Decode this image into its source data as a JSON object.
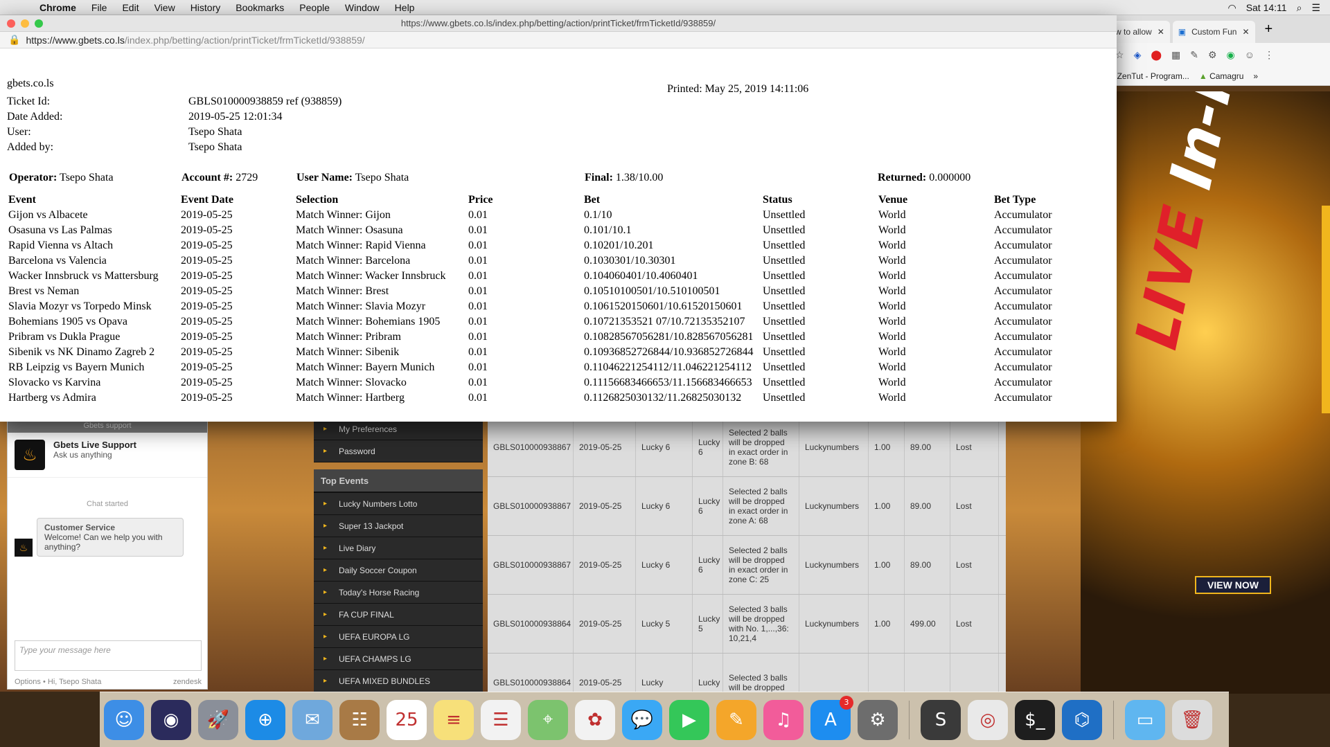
{
  "menubar": {
    "app": "Chrome",
    "items": [
      "File",
      "Edit",
      "View",
      "History",
      "Bookmarks",
      "People",
      "Window",
      "Help"
    ],
    "clock": "Sat 14:11"
  },
  "background_browser": {
    "tabs": [
      {
        "label": "w to allow"
      },
      {
        "label": "Custom Fun"
      }
    ],
    "bookmarks": [
      "ZenTut - Program...",
      "Camagru"
    ],
    "banner": {
      "live": "LIVE",
      "in_play": "In-Play",
      "cta": "VIEW NOW"
    }
  },
  "chat": {
    "header": "Gbets support",
    "agent_name": "Gbets Live Support",
    "agent_sub": "Ask us anything",
    "started": "Chat started",
    "msg_sender": "Customer Service",
    "msg_text": "Welcome! Can we help you with anything?",
    "input_placeholder": "Type your message here",
    "footer_left": "Options  •  Hi, Tsepo Shata",
    "footer_right": "zendesk"
  },
  "left_menu": {
    "account_items": [
      "My Preferences",
      "Password"
    ],
    "top_events_title": "Top Events",
    "top_events": [
      "Lucky Numbers Lotto",
      "Super 13 Jackpot",
      "Live Diary",
      "Daily Soccer Coupon",
      "Today's Horse Racing",
      "FA CUP FINAL",
      "UEFA EUROPA LG",
      "UEFA CHAMPS LG",
      "UEFA MIXED BUNDLES"
    ]
  },
  "results": {
    "rows": [
      {
        "ticket": "GBLS010000938867",
        "date": "2019-05-25",
        "game": "Lucky 6",
        "type": "Lucky 6",
        "desc": "Selected 2 balls will be dropped in exact order in zone B: 68",
        "category": "Luckynumbers",
        "stake": "1.00",
        "odds": "89.00",
        "result": "Lost"
      },
      {
        "ticket": "GBLS010000938867",
        "date": "2019-05-25",
        "game": "Lucky 6",
        "type": "Lucky 6",
        "desc": "Selected 2 balls will be dropped in exact order in zone A: 68",
        "category": "Luckynumbers",
        "stake": "1.00",
        "odds": "89.00",
        "result": "Lost"
      },
      {
        "ticket": "GBLS010000938867",
        "date": "2019-05-25",
        "game": "Lucky 6",
        "type": "Lucky 6",
        "desc": "Selected 2 balls will be dropped in exact order in zone C: 25",
        "category": "Luckynumbers",
        "stake": "1.00",
        "odds": "89.00",
        "result": "Lost"
      },
      {
        "ticket": "GBLS010000938864",
        "date": "2019-05-25",
        "game": "Lucky 5",
        "type": "Lucky 5",
        "desc": "Selected 3 balls will be dropped with No. 1,...,36: 10,21,4",
        "category": "Luckynumbers",
        "stake": "1.00",
        "odds": "499.00",
        "result": "Lost"
      },
      {
        "ticket": "GBLS010000938864",
        "date": "2019-05-25",
        "game": "Lucky",
        "type": "Lucky",
        "desc": "Selected 3 balls will be dropped",
        "category": "",
        "stake": "",
        "odds": "",
        "result": ""
      }
    ]
  },
  "popup": {
    "title_url": "https://www.gbets.co.ls/index.php/betting/action/printTicket/frmTicketId/938859/",
    "url_host": "https://www.gbets.co.ls",
    "url_path": "/index.php/betting/action/printTicket/frmTicketId/938859/"
  },
  "ticket": {
    "site": "gbets.co.ls",
    "printed": "Printed: May 25, 2019 14:11:06",
    "fields": [
      {
        "label": "Ticket Id:",
        "value": "GBLS010000938859 ref (938859)"
      },
      {
        "label": "Date Added:",
        "value": "2019-05-25 12:01:34"
      },
      {
        "label": "User:",
        "value": "Tsepo Shata"
      },
      {
        "label": "Added by:",
        "value": "Tsepo Shata"
      }
    ],
    "summary": {
      "operator_label": "Operator:",
      "operator": "Tsepo Shata",
      "account_label": "Account #:",
      "account": "2729",
      "username_label": "User Name:",
      "username": "Tsepo Shata",
      "final_label": "Final:",
      "final": "1.38/10.00",
      "returned_label": "Returned:",
      "returned": "0.000000"
    },
    "columns": [
      "Event",
      "Event Date",
      "Selection",
      "Price",
      "Bet",
      "Status",
      "Venue",
      "Bet Type"
    ],
    "bets": [
      [
        "Gijon vs Albacete",
        "2019-05-25",
        "Match Winner: Gijon",
        "0.01",
        "0.1/10",
        "Unsettled",
        "World",
        "Accumulator"
      ],
      [
        "Osasuna vs Las Palmas",
        "2019-05-25",
        "Match Winner: Osasuna",
        "0.01",
        "0.101/10.1",
        "Unsettled",
        "World",
        "Accumulator"
      ],
      [
        "Rapid Vienna vs Altach",
        "2019-05-25",
        "Match Winner: Rapid Vienna",
        "0.01",
        "0.10201/10.201",
        "Unsettled",
        "World",
        "Accumulator"
      ],
      [
        "Barcelona vs Valencia",
        "2019-05-25",
        "Match Winner: Barcelona",
        "0.01",
        "0.1030301/10.30301",
        "Unsettled",
        "World",
        "Accumulator"
      ],
      [
        "Wacker Innsbruck vs Mattersburg",
        "2019-05-25",
        "Match Winner: Wacker Innsbruck",
        "0.01",
        "0.104060401/10.4060401",
        "Unsettled",
        "World",
        "Accumulator"
      ],
      [
        "Brest vs Neman",
        "2019-05-25",
        "Match Winner: Brest",
        "0.01",
        "0.10510100501/10.510100501",
        "Unsettled",
        "World",
        "Accumulator"
      ],
      [
        "Slavia Mozyr vs Torpedo Minsk",
        "2019-05-25",
        "Match Winner: Slavia Mozyr",
        "0.01",
        "0.1061520150601/10.61520150601",
        "Unsettled",
        "World",
        "Accumulator"
      ],
      [
        "Bohemians 1905 vs Opava",
        "2019-05-25",
        "Match Winner: Bohemians 1905",
        "0.01",
        "0.10721353521 07/10.72135352107",
        "Unsettled",
        "World",
        "Accumulator"
      ],
      [
        "Pribram vs Dukla Prague",
        "2019-05-25",
        "Match Winner: Pribram",
        "0.01",
        "0.10828567056281/10.828567056281",
        "Unsettled",
        "World",
        "Accumulator"
      ],
      [
        "Sibenik vs NK Dinamo Zagreb 2",
        "2019-05-25",
        "Match Winner: Sibenik",
        "0.01",
        "0.10936852726844/10.936852726844",
        "Unsettled",
        "World",
        "Accumulator"
      ],
      [
        "RB Leipzig vs Bayern Munich",
        "2019-05-25",
        "Match Winner: Bayern Munich",
        "0.01",
        "0.11046221254112/11.046221254112",
        "Unsettled",
        "World",
        "Accumulator"
      ],
      [
        "Slovacko vs Karvina",
        "2019-05-25",
        "Match Winner: Slovacko",
        "0.01",
        "0.11156683466653/11.156683466653",
        "Unsettled",
        "World",
        "Accumulator"
      ],
      [
        "Hartberg vs Admira",
        "2019-05-25",
        "Match Winner: Hartberg",
        "0.01",
        "0.1126825030132/11.26825030132",
        "Unsettled",
        "World",
        "Accumulator"
      ]
    ]
  },
  "dock": {
    "apps": [
      {
        "name": "finder-icon",
        "color": "#3d8ee6",
        "glyph": "☺"
      },
      {
        "name": "siri-icon",
        "color": "#2b2b5c",
        "glyph": "◉"
      },
      {
        "name": "launchpad-icon",
        "color": "#8a8f99",
        "glyph": "🚀"
      },
      {
        "name": "safari-icon",
        "color": "#1c8be6",
        "glyph": "⊕"
      },
      {
        "name": "mail-icon",
        "color": "#6fa8dc",
        "glyph": "✉"
      },
      {
        "name": "contacts-icon",
        "color": "#a87a46",
        "glyph": "☷"
      },
      {
        "name": "calendar-icon",
        "color": "#ffffff",
        "glyph": "25"
      },
      {
        "name": "notes-icon",
        "color": "#f7e07a",
        "glyph": "≡"
      },
      {
        "name": "reminders-icon",
        "color": "#f2f2f2",
        "glyph": "☰"
      },
      {
        "name": "maps-icon",
        "color": "#7cc36e",
        "glyph": "⌖"
      },
      {
        "name": "photos-icon",
        "color": "#f2f2f2",
        "glyph": "✿"
      },
      {
        "name": "messages-icon",
        "color": "#3aa8f5",
        "glyph": "💬"
      },
      {
        "name": "facetime-icon",
        "color": "#34c759",
        "glyph": "▶"
      },
      {
        "name": "pages-icon",
        "color": "#f4a62a",
        "glyph": "✎"
      },
      {
        "name": "itunes-icon",
        "color": "#f25c9a",
        "glyph": "♫"
      },
      {
        "name": "app-store-icon",
        "color": "#1d8df0",
        "glyph": "A",
        "badge": "3"
      },
      {
        "name": "system-preferences-icon",
        "color": "#6d6d6d",
        "glyph": "⚙"
      },
      {
        "name": "sublime-text-icon",
        "color": "#3a3a3a",
        "glyph": "S"
      },
      {
        "name": "chrome-icon",
        "color": "#e9e9e9",
        "glyph": "◎"
      },
      {
        "name": "terminal-icon",
        "color": "#1e1e1e",
        "glyph": "$_"
      },
      {
        "name": "vscode-icon",
        "color": "#1f6fc5",
        "glyph": "⌬"
      },
      {
        "name": "downloads-folder-icon",
        "color": "#5fb6f0",
        "glyph": "▭"
      },
      {
        "name": "trash-icon",
        "color": "#dcdcdc",
        "glyph": "🗑"
      }
    ]
  }
}
